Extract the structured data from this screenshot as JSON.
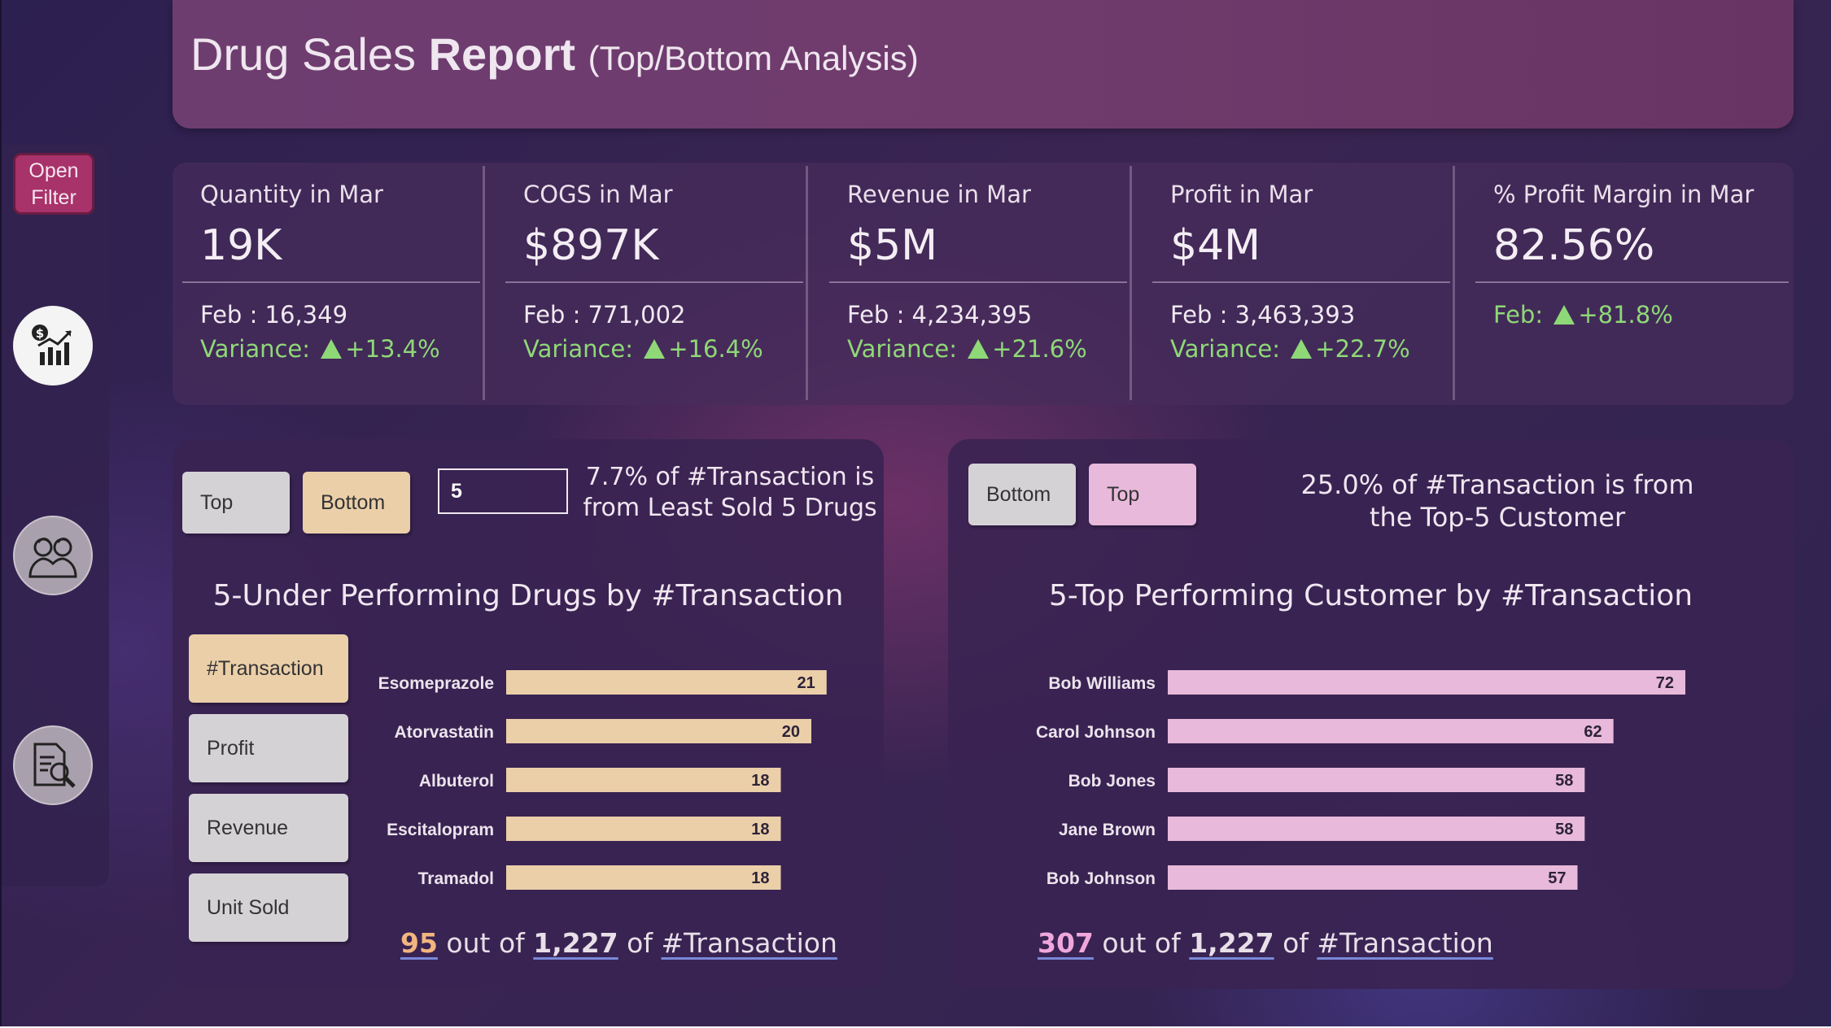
{
  "header": {
    "title_part1": "Drug Sales ",
    "title_bold": "Report",
    "title_sub": "(Top/Bottom Analysis)"
  },
  "sidebar": {
    "filter_label_line1": "Open",
    "filter_label_line2": "Filter",
    "icons": [
      "sales-chart-icon",
      "customers-icon",
      "report-search-icon"
    ]
  },
  "kpis": [
    {
      "label": "Quantity in Mar",
      "value": "19K",
      "prev": "Feb : 16,349",
      "variance_label": "Variance:",
      "variance": "+13.4%"
    },
    {
      "label": "COGS in Mar",
      "value": "$897K",
      "prev": "Feb : 771,002",
      "variance_label": "Variance:",
      "variance": "+16.4%"
    },
    {
      "label": "Revenue in Mar",
      "value": "$5M",
      "prev": "Feb : 4,234,395",
      "variance_label": "Variance:",
      "variance": "+21.6%"
    },
    {
      "label": "Profit in Mar",
      "value": "$4M",
      "prev": "Feb : 3,463,393",
      "variance_label": "Variance:",
      "variance": "+22.7%"
    },
    {
      "label": "% Profit Margin in Mar",
      "value": "82.56%",
      "prev_label": "Feb:",
      "prev_change": "+81.8%"
    }
  ],
  "left_panel": {
    "toggle_top": "Top",
    "toggle_bottom": "Bottom",
    "n_value": "5",
    "insight_line1": "7.7% of #Transaction is",
    "insight_line2": "from Least Sold 5 Drugs",
    "chart_title": "5-Under Performing Drugs by #Transaction",
    "metrics": [
      "#Transaction",
      "Profit",
      "Revenue",
      "Unit Sold"
    ],
    "footer": {
      "count": "95",
      "mid": " out of ",
      "total": "1,227",
      "of": " of ",
      "measure": "#Transaction"
    }
  },
  "right_panel": {
    "toggle_bottom": "Bottom",
    "toggle_top": "Top",
    "insight_line1": "25.0% of #Transaction is from",
    "insight_line2": "the Top-5 Customer",
    "chart_title": "5-Top Performing Customer by #Transaction",
    "footer": {
      "count": "307",
      "mid": " out of ",
      "total": "1,227",
      "of": " of ",
      "measure": "#Transaction"
    }
  },
  "colors": {
    "accent_green": "#8fd877",
    "bar_beige": "#ebcfa9",
    "bar_pink": "#e8b9da",
    "filter_button": "#a8326a"
  },
  "chart_data": [
    {
      "type": "bar",
      "orientation": "horizontal",
      "title": "5-Under Performing Drugs by #Transaction",
      "categories": [
        "Esomeprazole",
        "Atorvastatin",
        "Albuterol",
        "Escitalopram",
        "Tramadol"
      ],
      "values": [
        21,
        20,
        18,
        18,
        18
      ],
      "xlim": [
        0,
        48
      ],
      "color": "#ebcfa9",
      "data_labels": true,
      "grid": false
    },
    {
      "type": "bar",
      "orientation": "horizontal",
      "title": "5-Top Performing Customer by #Transaction",
      "categories": [
        "Bob Williams",
        "Carol Johnson",
        "Bob Jones",
        "Jane Brown",
        "Bob Johnson"
      ],
      "values": [
        72,
        62,
        58,
        58,
        57
      ],
      "xlim": [
        0,
        72
      ],
      "color": "#e8b9da",
      "data_labels": true,
      "grid": false
    }
  ]
}
